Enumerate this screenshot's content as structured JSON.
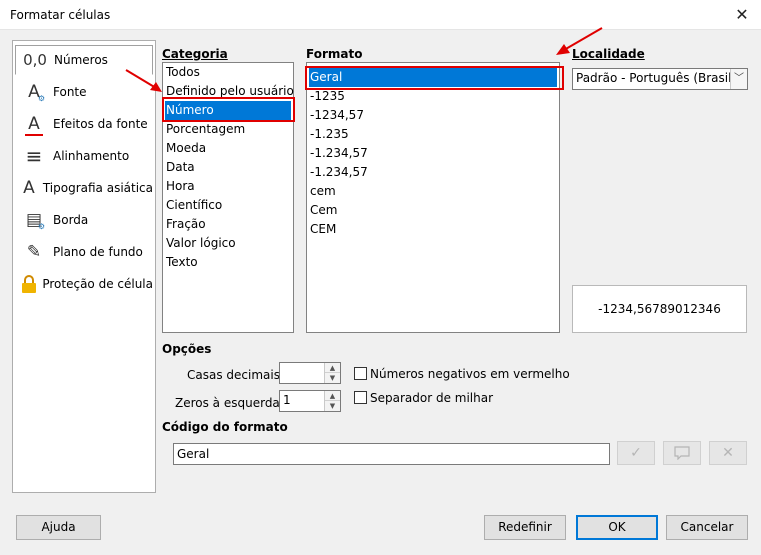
{
  "window": {
    "title": "Formatar células"
  },
  "nav": {
    "items": [
      {
        "label": "Números",
        "icon": "numbers-icon",
        "glyph": "0,0"
      },
      {
        "label": "Fonte",
        "icon": "font-icon",
        "glyph": "A"
      },
      {
        "label": "Efeitos da fonte",
        "icon": "font-effects-icon",
        "glyph": "A"
      },
      {
        "label": "Alinhamento",
        "icon": "alignment-icon",
        "glyph": "≡"
      },
      {
        "label": "Tipografia asiática",
        "icon": "asian-typography-icon",
        "glyph": "A"
      },
      {
        "label": "Borda",
        "icon": "borders-icon",
        "glyph": "▤"
      },
      {
        "label": "Plano de fundo",
        "icon": "background-icon",
        "glyph": "✎"
      },
      {
        "label": "Proteção de célula",
        "icon": "cell-protection-icon",
        "glyph": "🔒"
      }
    ]
  },
  "categoria": {
    "heading": "Categoria",
    "items": [
      "Todos",
      "Definido pelo usuário",
      "Número",
      "Porcentagem",
      "Moeda",
      "Data",
      "Hora",
      "Científico",
      "Fração",
      "Valor lógico",
      "Texto"
    ],
    "selected": "Número"
  },
  "formato": {
    "heading": "Formato",
    "items": [
      "Geral",
      "-1235",
      "-1234,57",
      "-1.235",
      "-1.234,57",
      "-1.234,57",
      "cem",
      "Cem",
      "CEM"
    ],
    "selected": "Geral"
  },
  "localidade": {
    "heading": "Localidade",
    "value": "Padrão - Português (Brasil)"
  },
  "preview": {
    "value": "-1234,56789012346"
  },
  "opcoes": {
    "heading": "Opções",
    "casas_decimais_label": "Casas decimais:",
    "casas_decimais_value": "",
    "zeros_label": "Zeros à esquerda:",
    "zeros_value": "1",
    "negativos_label": "Números negativos em vermelho",
    "separador_label": "Separador de milhar"
  },
  "codigo": {
    "heading": "Código do formato",
    "value": "Geral"
  },
  "buttons": {
    "ajuda": "Ajuda",
    "redefinir": "Redefinir",
    "ok": "OK",
    "cancelar": "Cancelar"
  },
  "colors": {
    "selection": "#0078d7",
    "annotation": "#e00000"
  }
}
